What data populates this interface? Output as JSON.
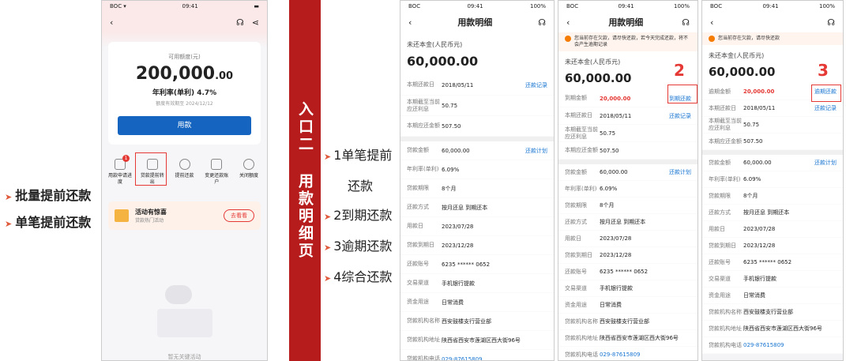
{
  "left_bullets": [
    "批量提前还款",
    "单笔提前还款"
  ],
  "banner_text": "入口二 用款明细页",
  "mid_bullets": [
    "1单笔提前",
    "还款",
    "2到期还款",
    "3逾期还款",
    "4综合还款"
  ],
  "phone1": {
    "carrier": "BOC",
    "time": "09:41",
    "limit_label": "可用额度(元)",
    "limit_int": "200,000",
    "limit_dec": ".00",
    "rate": "年利率(单利) 4.7%",
    "expire": "额度有效期至 2024/12/12",
    "btn": "用款",
    "badge": "1",
    "icons": [
      "用款申请进度",
      "贷款提前转出",
      "提前还款",
      "变更还款账户",
      "关闭额度"
    ],
    "promo_title": "活动有惊喜",
    "promo_sub": "贷款热门活动",
    "promo_btn": "去看看",
    "empty": "暂无关键活动"
  },
  "phone2": {
    "carrier": "BOC",
    "time": "09:41",
    "battery": "100%",
    "title": "用款明细",
    "principal_label": "未还本金(人民币元)",
    "principal": "60,000.00",
    "rows1": [
      [
        "本期还款日",
        "2018/05/11",
        "还款记录"
      ],
      [
        "本期截至当前应还利息",
        "50.75",
        ""
      ],
      [
        "本期应还金额",
        "507.50",
        ""
      ]
    ],
    "rows2": [
      [
        "贷款金额",
        "60,000.00",
        "还款计划"
      ],
      [
        "年利率(单利)",
        "6.09%",
        ""
      ],
      [
        "贷款期限",
        "8个月",
        ""
      ],
      [
        "还款方式",
        "按月还息 到期还本",
        ""
      ],
      [
        "用款日",
        "2023/07/28",
        ""
      ],
      [
        "贷款到期日",
        "2023/12/28",
        ""
      ],
      [
        "还款账号",
        "6235 ****** 0652",
        ""
      ],
      [
        "交易渠道",
        "手机银行提款",
        ""
      ],
      [
        "资金用途",
        "日常消费",
        ""
      ],
      [
        "贷款机构名称",
        "西安鼓楼支行营业部",
        ""
      ],
      [
        "贷款机构地址",
        "陕西省西安市莲湖区西大街96号",
        ""
      ],
      [
        "贷款机构电话",
        "029-87615809",
        ""
      ]
    ]
  },
  "phone3": {
    "carrier": "BOC",
    "time": "09:41",
    "battery": "100%",
    "title": "用款明细",
    "tip": "您当前存在欠款，请尽快还款，若今天完成还款，将不会产生逾期记录",
    "principal_label": "未还本金(人民币元)",
    "principal": "60,000.00",
    "num": "2",
    "rows1": [
      [
        "到期金额",
        "20,000.00",
        "到期还款"
      ],
      [
        "本期还款日",
        "2018/05/11",
        "还款记录"
      ],
      [
        "本期截至当前应还利息",
        "50.75",
        ""
      ],
      [
        "本期应还金额",
        "507.50",
        ""
      ]
    ],
    "rows2": [
      [
        "贷款金额",
        "60,000.00",
        "还款计划"
      ],
      [
        "年利率(单利)",
        "6.09%",
        ""
      ],
      [
        "贷款期限",
        "8个月",
        ""
      ],
      [
        "还款方式",
        "按月还息 到期还本",
        ""
      ],
      [
        "用款日",
        "2023/07/28",
        ""
      ],
      [
        "贷款到期日",
        "2023/12/28",
        ""
      ],
      [
        "还款账号",
        "6235 ****** 0652",
        ""
      ],
      [
        "交易渠道",
        "手机银行提款",
        ""
      ],
      [
        "资金用途",
        "日常消费",
        ""
      ],
      [
        "贷款机构名称",
        "西安鼓楼支行营业部",
        ""
      ],
      [
        "贷款机构地址",
        "陕西省西安市莲湖区西大街96号",
        ""
      ],
      [
        "贷款机构电话",
        "029-87615809",
        ""
      ]
    ]
  },
  "phone4": {
    "carrier": "BOC",
    "time": "09:41",
    "battery": "100%",
    "tip": "您当前存在欠款，请尽快还款",
    "principal_label": "未还本金(人民币元)",
    "principal": "60,000.00",
    "num": "3",
    "rows1": [
      [
        "逾期金额",
        "20,000.00",
        "逾期还款"
      ],
      [
        "本期还款日",
        "2018/05/11",
        "还款记录"
      ],
      [
        "本期截至当前应还利息",
        "50.75",
        ""
      ],
      [
        "本期应还金额",
        "507.50",
        ""
      ]
    ],
    "rows2": [
      [
        "贷款金额",
        "60,000.00",
        "还款计划"
      ],
      [
        "年利率(单利)",
        "6.09%",
        ""
      ],
      [
        "贷款期限",
        "8个月",
        ""
      ],
      [
        "还款方式",
        "按月还息 到期还本",
        ""
      ],
      [
        "用款日",
        "2023/07/28",
        ""
      ],
      [
        "贷款到期日",
        "2023/12/28",
        ""
      ],
      [
        "还款账号",
        "6235 ****** 0652",
        ""
      ],
      [
        "交易渠道",
        "手机银行提款",
        ""
      ],
      [
        "资金用途",
        "日常消费",
        ""
      ],
      [
        "贷款机构名称",
        "西安鼓楼支行营业部",
        ""
      ],
      [
        "贷款机构地址",
        "陕西省西安市莲湖区西大街96号",
        ""
      ],
      [
        "贷款机构电话",
        "029-87615809",
        ""
      ]
    ]
  },
  "colors": {
    "banner": "#b71c1c",
    "accent_blue": "#1976d2",
    "red": "#e53935"
  }
}
